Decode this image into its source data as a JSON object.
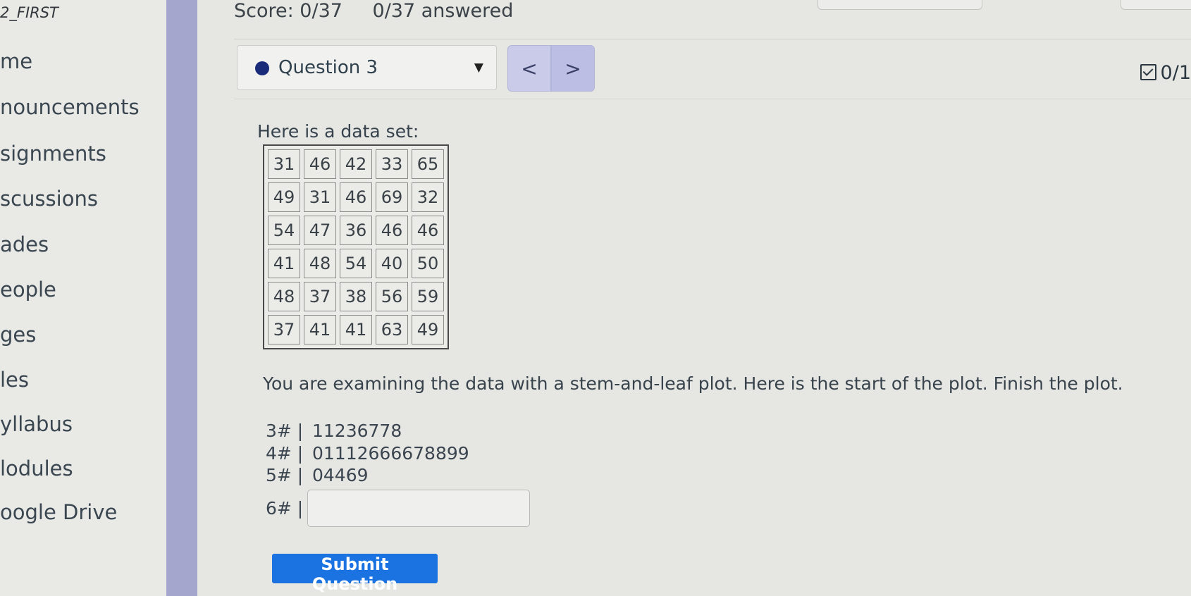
{
  "sidebar": {
    "course_title": "2_FIRST",
    "items": [
      {
        "label": "me"
      },
      {
        "label": "nouncements"
      },
      {
        "label": "signments"
      },
      {
        "label": "scussions"
      },
      {
        "label": "ades"
      },
      {
        "label": "eople"
      },
      {
        "label": "ges"
      },
      {
        "label": "les"
      },
      {
        "label": "yllabus"
      },
      {
        "label": "lodules"
      },
      {
        "label": "oogle Drive"
      }
    ]
  },
  "header": {
    "score": "Score: 0/37",
    "answered": "0/37 answered"
  },
  "question_nav": {
    "selected": "Question 3",
    "prev_label": "<",
    "next_label": ">",
    "points": "0/1"
  },
  "question": {
    "intro": "Here is a data set:",
    "data_rows": [
      [
        "31",
        "46",
        "42",
        "33",
        "65"
      ],
      [
        "49",
        "31",
        "46",
        "69",
        "32"
      ],
      [
        "54",
        "47",
        "36",
        "46",
        "46"
      ],
      [
        "41",
        "48",
        "54",
        "40",
        "50"
      ],
      [
        "48",
        "37",
        "38",
        "56",
        "59"
      ],
      [
        "37",
        "41",
        "41",
        "63",
        "49"
      ]
    ],
    "instruction": "You are examining the data with a stem-and-leaf plot. Here is the start of the plot. Finish the plot.",
    "plot": [
      {
        "stem": "3# |",
        "leaves": "11236778"
      },
      {
        "stem": "4# |",
        "leaves": "01112666678899"
      },
      {
        "stem": "5# |",
        "leaves": "04469"
      }
    ],
    "answer_stem": "6# |",
    "answer_value": "",
    "submit_label": "Submit Question"
  }
}
